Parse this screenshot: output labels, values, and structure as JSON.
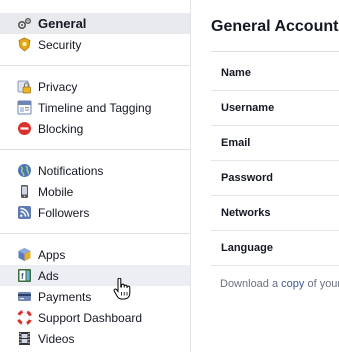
{
  "sidebar": {
    "items": [
      {
        "label": "General",
        "icon": "gears-icon"
      },
      {
        "label": "Security",
        "icon": "security-badge-icon"
      },
      {
        "label": "Privacy",
        "icon": "lock-icon"
      },
      {
        "label": "Timeline and Tagging",
        "icon": "timeline-icon"
      },
      {
        "label": "Blocking",
        "icon": "blocking-icon"
      },
      {
        "label": "Notifications",
        "icon": "globe-icon"
      },
      {
        "label": "Mobile",
        "icon": "mobile-icon"
      },
      {
        "label": "Followers",
        "icon": "rss-icon"
      },
      {
        "label": "Apps",
        "icon": "apps-cube-icon"
      },
      {
        "label": "Ads",
        "icon": "ads-icon"
      },
      {
        "label": "Payments",
        "icon": "payments-icon"
      },
      {
        "label": "Support Dashboard",
        "icon": "lifebuoy-icon"
      },
      {
        "label": "Videos",
        "icon": "film-icon"
      }
    ],
    "selected": "General",
    "hovered": "Ads"
  },
  "main": {
    "title": "General Account",
    "rows": [
      "Name",
      "Username",
      "Email",
      "Password",
      "Networks",
      "Language"
    ],
    "download_prefix": "Download a ",
    "download_link": "copy",
    "download_suffix": " of your"
  },
  "colors": {
    "link": "#3b5998",
    "selected_bg": "#e9eaed",
    "divider": "#dddfe2"
  }
}
